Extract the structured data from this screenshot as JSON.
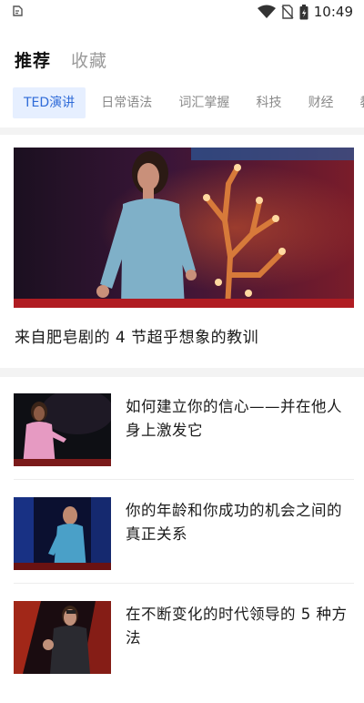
{
  "status_bar": {
    "time": "10:49",
    "icons": [
      "notification-icon",
      "wifi-icon",
      "no-sim-icon",
      "battery-icon"
    ]
  },
  "main_tabs": [
    {
      "label": "推荐",
      "active": true
    },
    {
      "label": "收藏",
      "active": false
    }
  ],
  "categories": [
    "TED演讲",
    "日常语法",
    "词汇掌握",
    "科技",
    "财经",
    "教育"
  ],
  "featured": {
    "title": "来自肥皂剧的 4 节超乎想象的教训"
  },
  "articles": [
    {
      "title": "如何建立你的信心——并在他人身上激发它"
    },
    {
      "title": "你的年龄和你成功的机会之间的真正关系"
    },
    {
      "title": "在不断变化的时代领导的 5 种方法"
    }
  ],
  "colors": {
    "accent": "#2f6bd8",
    "chip_bg": "#e6efff",
    "separator": "#f3f3f3"
  }
}
